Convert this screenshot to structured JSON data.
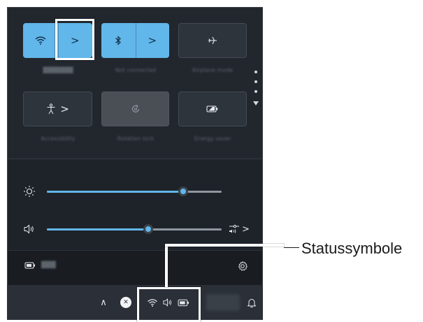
{
  "callout": {
    "label": "Statussymbole"
  },
  "tiles": [
    {
      "name": "wifi",
      "icon": "wifi-icon",
      "glyph": "◔",
      "has_expand": true,
      "expand_glyph": ">",
      "state": "on",
      "caption": "███████"
    },
    {
      "name": "bluetooth",
      "icon": "bluetooth-icon",
      "glyph": "✱",
      "has_expand": true,
      "expand_glyph": ">",
      "state": "on",
      "caption": "Not connected"
    },
    {
      "name": "airplane-mode",
      "icon": "airplane-icon",
      "glyph": "✈",
      "has_expand": false,
      "state": "off",
      "caption": "Airplane mode"
    },
    {
      "name": "accessibility",
      "icon": "accessibility-icon",
      "glyph": "☺",
      "has_expand": true,
      "expand_glyph": ">",
      "state": "off",
      "caption": "Accessibility"
    },
    {
      "name": "rotation-lock",
      "icon": "rotation-lock-icon",
      "glyph": "↻",
      "has_expand": false,
      "state": "disabled",
      "caption": "Rotation lock"
    },
    {
      "name": "energy-saver",
      "icon": "energy-saver-icon",
      "glyph": "◐",
      "has_expand": false,
      "state": "off",
      "caption": "Energy saver"
    }
  ],
  "sliders": {
    "brightness": {
      "icon": "brightness-icon",
      "value": 0.78
    },
    "volume": {
      "icon": "volume-icon",
      "value": 0.58,
      "end_icon": "audio-output-icon",
      "end_glyph": ">"
    }
  },
  "footer": {
    "battery_icon": "battery-icon",
    "battery_text": "███",
    "settings_icon": "settings-icon"
  },
  "taskbar": {
    "chevron_up": "∧",
    "close_badge": "✕",
    "wifi_icon": "wifi-icon",
    "volume_icon": "volume-icon",
    "battery_icon": "battery-icon",
    "notification_icon": "bell-icon"
  },
  "colors": {
    "accent": "#61b6ea",
    "panel": "#22272e",
    "tile_off": "#2e343c",
    "highlight": "#ffffff"
  }
}
